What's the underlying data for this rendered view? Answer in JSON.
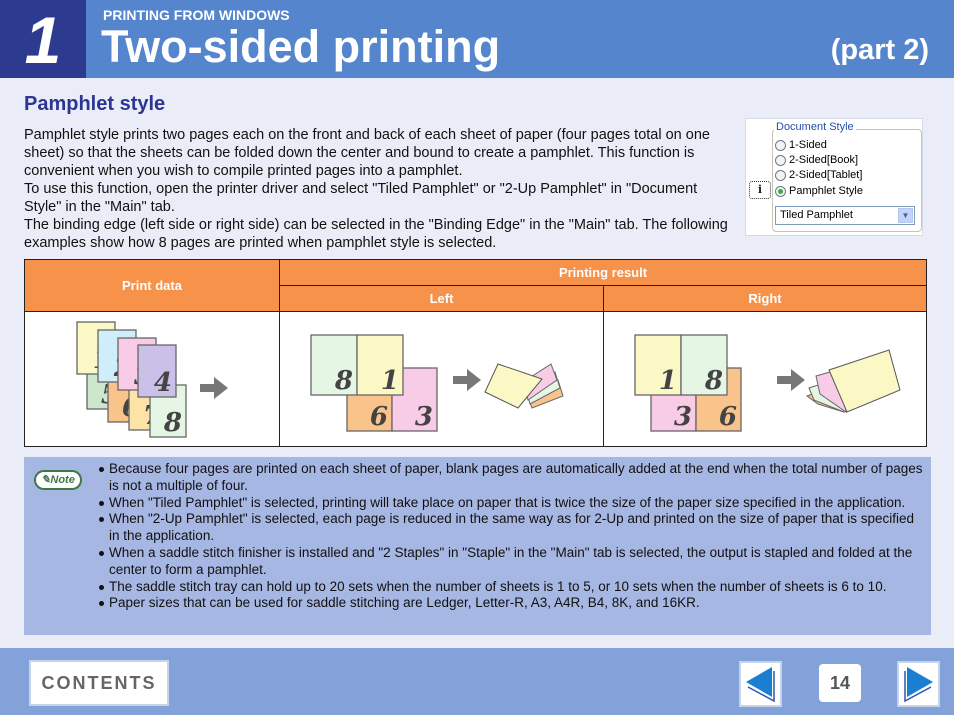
{
  "header": {
    "chapter_number": "1",
    "section": "PRINTING FROM WINDOWS",
    "title": "Two-sided printing",
    "part": "(part 2)"
  },
  "subheading": "Pamphlet style",
  "intro": [
    "Pamphlet style prints two pages each on the front and back of each sheet of paper (four pages total on one sheet) so that the sheets can be folded down the center and bound to create a pamphlet. This function is convenient when you wish to compile printed pages into a pamphlet.",
    "To use this function, open the printer driver and select \"Tiled Pamphlet\" or \"2-Up Pamphlet\" in \"Document Style\" in the \"Main\" tab.",
    "The binding edge (left side or right side) can be selected in the \"Binding Edge\" in the \"Main\" tab. The following examples show how 8 pages are printed when pamphlet style is selected."
  ],
  "dialog": {
    "group_label": "Document Style",
    "options": [
      "1-Sided",
      "2-Sided[Book]",
      "2-Sided[Tablet]",
      "Pamphlet Style"
    ],
    "selected_option": "Pamphlet Style",
    "dropdown_value": "Tiled Pamphlet",
    "info_icon": "i"
  },
  "table": {
    "col_print_data": "Print data",
    "col_printing_result": "Printing result",
    "col_left": "Left",
    "col_right": "Right",
    "print_data_pages": [
      "1",
      "2",
      "3",
      "4",
      "5",
      "6",
      "7",
      "8"
    ],
    "left_sheet_front": [
      "8",
      "1"
    ],
    "left_sheet_back": [
      "6",
      "3"
    ],
    "right_sheet_front": [
      "1",
      "8"
    ],
    "right_sheet_back": [
      "3",
      "6"
    ]
  },
  "note": {
    "badge": "Note",
    "items": [
      "Because four pages are printed on each sheet of paper, blank pages are automatically added at the end when the total number of pages is not a multiple of four.",
      "When \"Tiled Pamphlet\" is selected, printing will take place on paper that is twice the size of the paper size specified in the application.",
      "When \"2-Up Pamphlet\" is selected, each page is reduced in the same way as for 2-Up and printed on the size of paper that is specified in the application.",
      "When a saddle stitch finisher is installed and \"2 Staples\" in \"Staple\" in the \"Main\" tab is selected, the output is stapled and folded at the center to form a pamphlet.",
      "The saddle stitch tray can hold up to 20 sets when the number of sheets is 1 to 5, or 10 sets when the number of sheets is 6 to 10.",
      "Paper sizes that can be used for saddle stitching are Ledger, Letter-R, A3, A4R, B4, 8K, and 16KR."
    ]
  },
  "footer": {
    "contents_label": "CONTENTS",
    "page_number": "14"
  },
  "colors": {
    "header_blue": "#5585cc",
    "chapter_navy": "#2c3a90",
    "table_orange": "#f7924a",
    "note_bg": "#a7b7e3",
    "footer_blue": "#82a2d9",
    "nav_arrow": "#1a7fd0"
  }
}
